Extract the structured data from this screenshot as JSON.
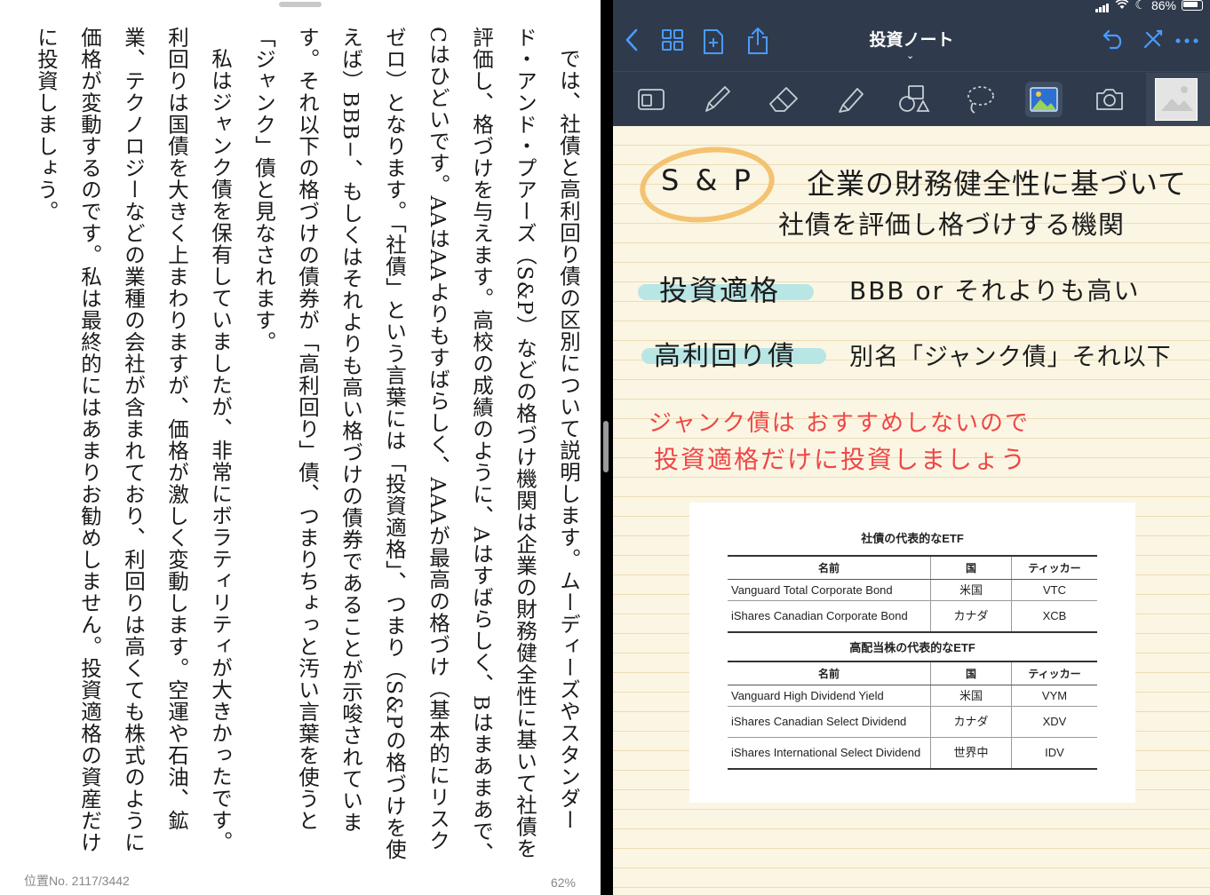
{
  "kindle": {
    "paragraphs": [
      "では、社債と高利回り債の区別について説明します。ムーディーズやスタンダード・アンド・プアーズ（S&P）などの格づけ機関は企業の財務健全性に基いて社債を評価し、格づけを与えます。高校の成績のように、Aはすばらしく、Bはまあまあで、Cはひどいです。AAはAAよりもすばらしく、AAAが最高の格づけ（基本的にリスクゼロ）となります。「社債」という言葉には「投資適格」、つまり（S&Pの格づけを使えば）BBB−、もしくはそれよりも高い格づけの債券であることが示唆されています。それ以下の格づけの債券が「高利回り」債、つまりちょっと汚い言葉を使うと「ジャンク」債と見なされます。",
      "私はジャンク債を保有していましたが、非常にボラティリティが大きかったです。利回りは国債を大きく上まわりますが、価格が激しく変動します。空運や石油、鉱業、テクノロジーなどの業種の会社が含まれており、利回りは高くても株式のように価格が変動するのです。私は最終的にはあまりお勧めしません。投資適格の資産だけに投資しましょう。"
    ],
    "location": "位置No. 2117/3442",
    "percent": "62%"
  },
  "status": {
    "battery": "86%"
  },
  "goodnotes": {
    "title": "投資ノート",
    "title_chevron": "⌄",
    "nav_icons": [
      "back-chevron-icon",
      "grid-icon",
      "add-page-icon",
      "share-icon",
      "undo-icon",
      "pen-close-icon",
      "more-icon"
    ],
    "tools": [
      "zoom-window-icon",
      "pen-icon",
      "eraser-icon",
      "highlighter-icon",
      "shapes-icon",
      "lasso-icon",
      "image-icon",
      "camera-icon"
    ],
    "notes": {
      "sp": "S & P",
      "sp_desc_1": "企業の財務健全性に基づいて",
      "sp_desc_2": "社債を評価し格づけする機関",
      "inv_grade": "投資適格",
      "inv_grade_desc": "BBB  or  それよりも高い",
      "high_yield": "高利回り債",
      "high_yield_desc": "別名「ジャンク債」それ以下",
      "red_1": "ジャンク債は おすすめしないので",
      "red_2": "投資適格だけに投資しましょう"
    },
    "etf": {
      "title1": "社債の代表的なETF",
      "title2": "高配当株の代表的なETF",
      "headers": [
        "名前",
        "国",
        "ティッカー"
      ],
      "table1": [
        [
          "Vanguard Total Corporate Bond",
          "米国",
          "VTC"
        ],
        [
          "iShares Canadian Corporate Bond",
          "カナダ",
          "XCB"
        ]
      ],
      "table2": [
        [
          "Vanguard High Dividend Yield",
          "米国",
          "VYM"
        ],
        [
          "iShares Canadian Select Dividend",
          "カナダ",
          "XDV"
        ],
        [
          "iShares International Select Dividend",
          "世界中",
          "IDV"
        ]
      ]
    }
  },
  "colors": {
    "toolbar": "#2f3b4c",
    "accent": "#4a9bff",
    "paper": "#fbf6e3",
    "highlight": "#b8e6e5",
    "circle": "#f4c271",
    "red_ink": "#ee4747"
  }
}
